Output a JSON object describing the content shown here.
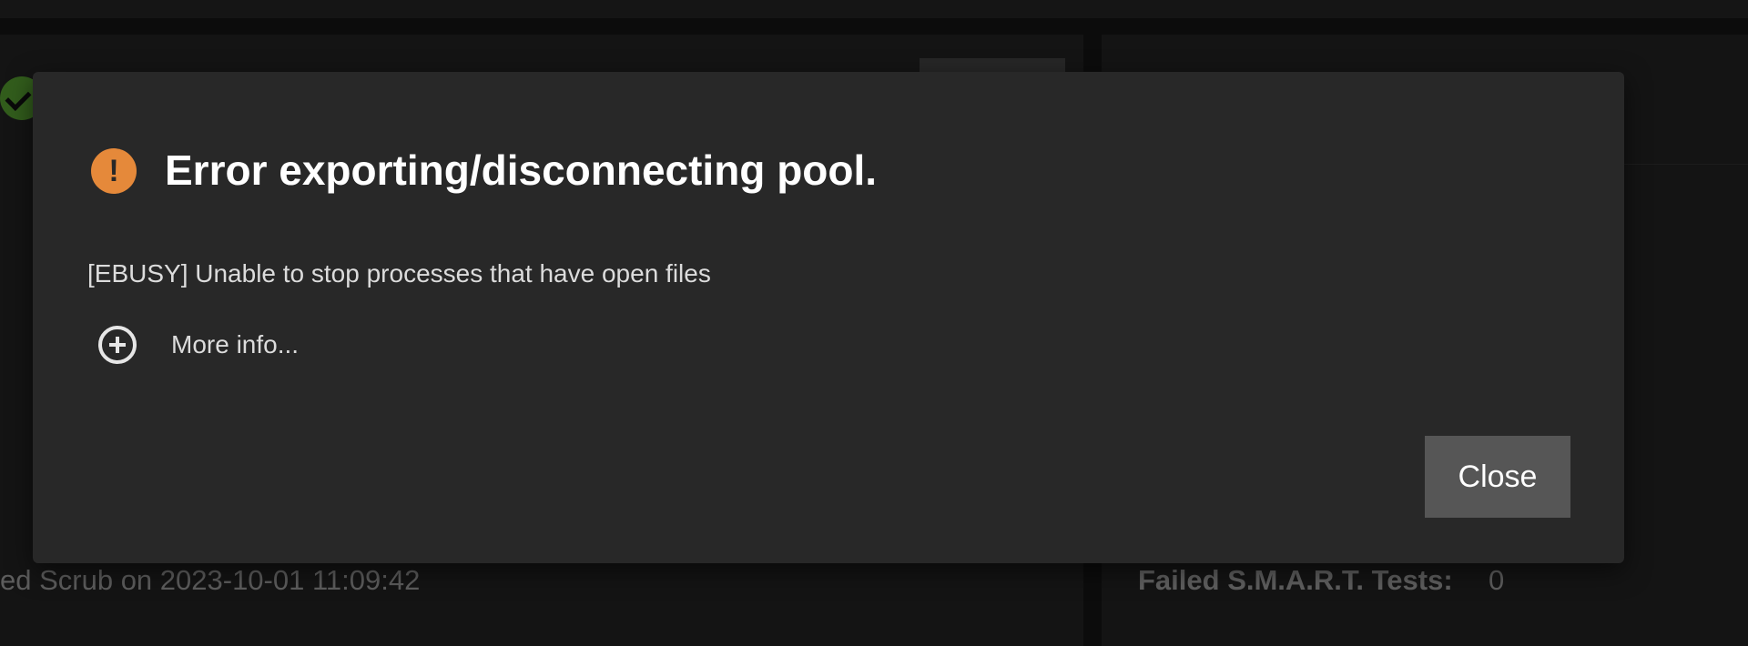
{
  "background": {
    "scrub_text": "ed Scrub on 2023-10-01 11:09:42",
    "smart_label": "Failed S.M.A.R.T. Tests:",
    "smart_value": "0"
  },
  "dialog": {
    "icon": "warning-icon",
    "title": "Error exporting/disconnecting pool.",
    "message": "[EBUSY] Unable to stop processes that have open files",
    "more_info_icon": "plus-circle-icon",
    "more_info_label": "More info...",
    "close_label": "Close",
    "accent": "#e5893a"
  }
}
